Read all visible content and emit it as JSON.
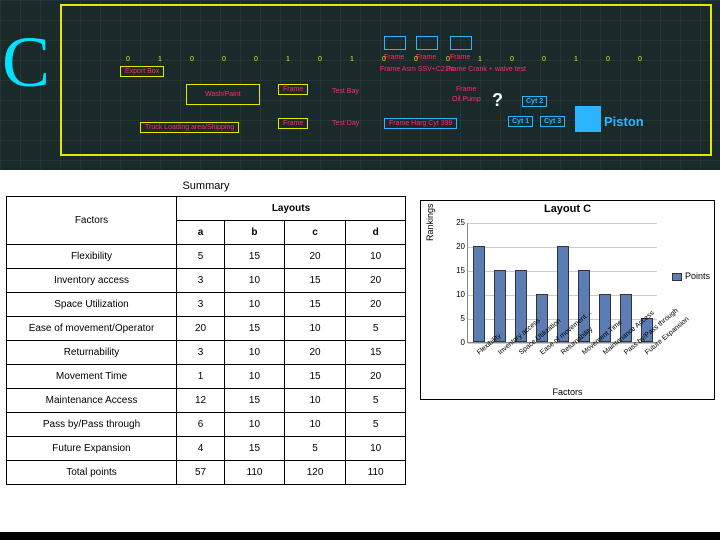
{
  "cad": {
    "letter": "C",
    "question_mark": "?",
    "labels": {
      "export_box": "Export Box",
      "wash_paint": "Wash/Paint",
      "truck_loading": "Truck Loading area/Shipping",
      "frame": "Frame",
      "test_bay": "Test Bay",
      "test_day": "Test Day",
      "frame_asm_ssv": "Frame Asm SSV+C21N",
      "oil_pump": "Oil Pump",
      "frame_crank": "Frame Crank + walve test",
      "cyt_1": "Cyt 1",
      "cyt_2": "Cyt 2",
      "cyt_3": "Cyt 3",
      "piston": "Piston",
      "frame_harg": "Frame Harg Cyt 399"
    }
  },
  "table": {
    "title": "Summary",
    "headers": {
      "factors": "Factors",
      "layouts": "Layouts"
    },
    "columns": [
      "a",
      "b",
      "c",
      "d"
    ],
    "rows": [
      {
        "factor": "Flexibility",
        "v": [
          5,
          15,
          20,
          10
        ]
      },
      {
        "factor": "Inventory access",
        "v": [
          3,
          10,
          15,
          20
        ]
      },
      {
        "factor": "Space Utilization",
        "v": [
          3,
          10,
          15,
          20
        ]
      },
      {
        "factor": "Ease of movement/Operator",
        "v": [
          20,
          15,
          10,
          5
        ]
      },
      {
        "factor": "Returnability",
        "v": [
          3,
          10,
          20,
          15
        ]
      },
      {
        "factor": "Movement Time",
        "v": [
          1,
          10,
          15,
          20
        ]
      },
      {
        "factor": "Maintenance Access",
        "v": [
          12,
          15,
          10,
          5
        ]
      },
      {
        "factor": "Pass by/Pass through",
        "v": [
          6,
          10,
          10,
          5
        ]
      },
      {
        "factor": "Future Expansion",
        "v": [
          4,
          15,
          5,
          10
        ]
      }
    ],
    "total": {
      "label": "Total points",
      "v": [
        57,
        110,
        120,
        110
      ]
    }
  },
  "chart_data": {
    "type": "bar",
    "title": "Layout C",
    "xlabel": "Factors",
    "ylabel": "Rankings",
    "ylim": [
      0,
      25
    ],
    "yticks": [
      0,
      5,
      10,
      15,
      20,
      25
    ],
    "legend": "Points",
    "categories": [
      "Flexibility",
      "Inventory access",
      "Space Utilization",
      "Ease of movement…",
      "Returnability",
      "Movement Time",
      "Maintenance Access",
      "Pass by/Pass through",
      "Future Expansion"
    ],
    "values": [
      20,
      15,
      15,
      10,
      20,
      15,
      10,
      10,
      5
    ]
  }
}
